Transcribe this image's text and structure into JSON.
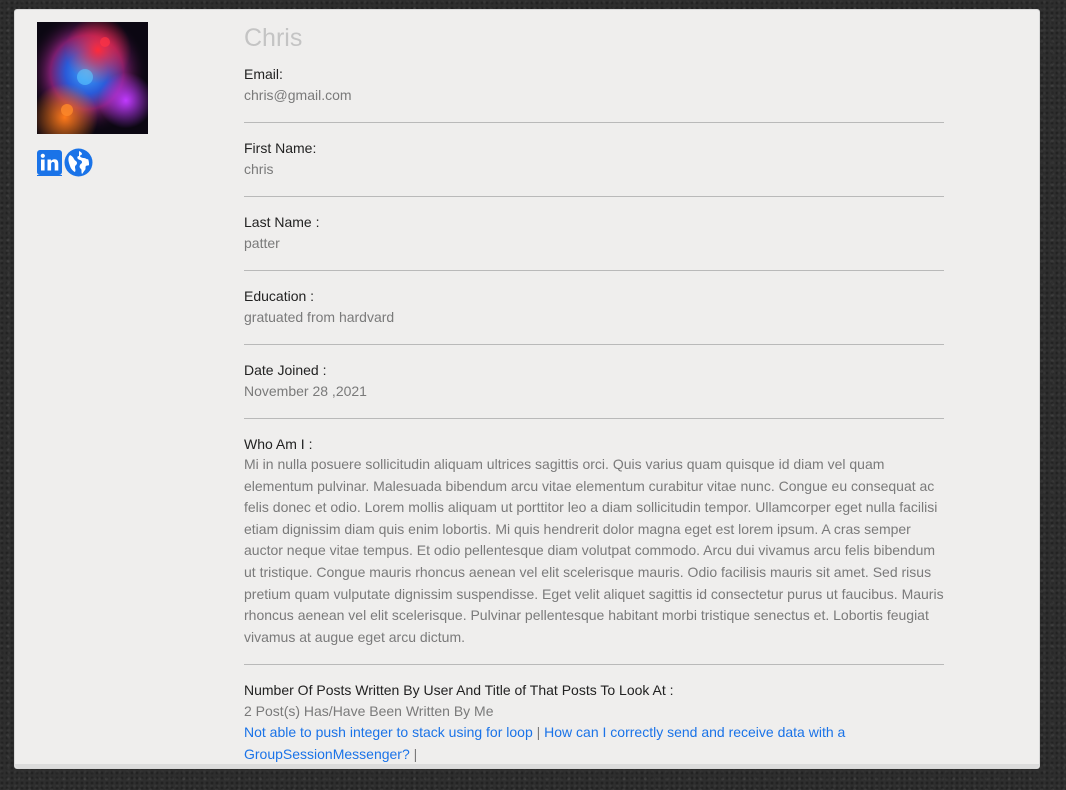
{
  "profile": {
    "name": "Chris",
    "fields": {
      "email": {
        "label": "Email:",
        "value": "chris@gmail.com"
      },
      "first_name": {
        "label": "First Name:",
        "value": "chris"
      },
      "last_name": {
        "label": "Last Name :",
        "value": "patter"
      },
      "education": {
        "label": "Education :",
        "value": "gratuated from hardvard"
      },
      "date_joined": {
        "label": "Date Joined :",
        "value": "November 28 ,2021"
      },
      "who_am_i": {
        "label": "Who Am I :",
        "value": "Mi in nulla posuere sollicitudin aliquam ultrices sagittis orci. Quis varius quam quisque id diam vel quam elementum pulvinar. Malesuada bibendum arcu vitae elementum curabitur vitae nunc. Congue eu consequat ac felis donec et odio. Lorem mollis aliquam ut porttitor leo a diam sollicitudin tempor. Ullamcorper eget nulla facilisi etiam dignissim diam quis enim lobortis. Mi quis hendrerit dolor magna eget est lorem ipsum. A cras semper auctor neque vitae tempus. Et odio pellentesque diam volutpat commodo. Arcu dui vivamus arcu felis bibendum ut tristique. Congue mauris rhoncus aenean vel elit scelerisque mauris. Odio facilisis mauris sit amet. Sed risus pretium quam vulputate dignissim suspendisse. Eget velit aliquet sagittis id consectetur purus ut faucibus. Mauris rhoncus aenean vel elit scelerisque. Pulvinar pellentesque habitant morbi tristique senectus et. Lobortis feugiat vivamus at augue eget arcu dictum."
      }
    },
    "posts": {
      "label": "Number Of Posts Written By User And Title of That Posts To Look At :",
      "count_text": "2 Post(s) Has/Have Been Written By Me",
      "separator": "|",
      "items": [
        {
          "title": "Not able to push integer to stack using for loop"
        },
        {
          "title": "How can I correctly send and receive data with a GroupSessionMessenger?"
        }
      ]
    },
    "social": {
      "linkedin_icon": "linkedin-icon",
      "website_icon": "globe-icon"
    }
  },
  "colors": {
    "card_background": "#efeeed",
    "page_background": "#2e2e2e",
    "link": "#1a73e8",
    "name": "#c4c4c4",
    "value_text": "#7a7a7a"
  }
}
